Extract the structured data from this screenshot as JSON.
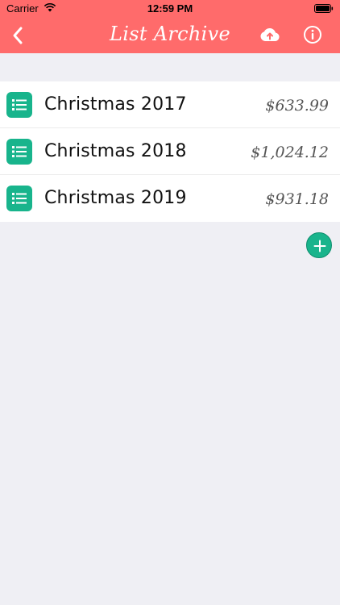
{
  "status_bar": {
    "carrier": "Carrier",
    "time": "12:59 PM"
  },
  "nav": {
    "title": "List Archive",
    "back_icon": "chevron-left-icon",
    "cloud_icon": "cloud-upload-icon",
    "info_icon": "info-icon"
  },
  "colors": {
    "header": "#ff6b6b",
    "accent": "#18b48c",
    "background": "#efeff4"
  },
  "lists": [
    {
      "title": "Christmas 2017",
      "amount": "$633.99"
    },
    {
      "title": "Christmas 2018",
      "amount": "$1,024.12"
    },
    {
      "title": "Christmas 2019",
      "amount": "$931.18"
    }
  ]
}
